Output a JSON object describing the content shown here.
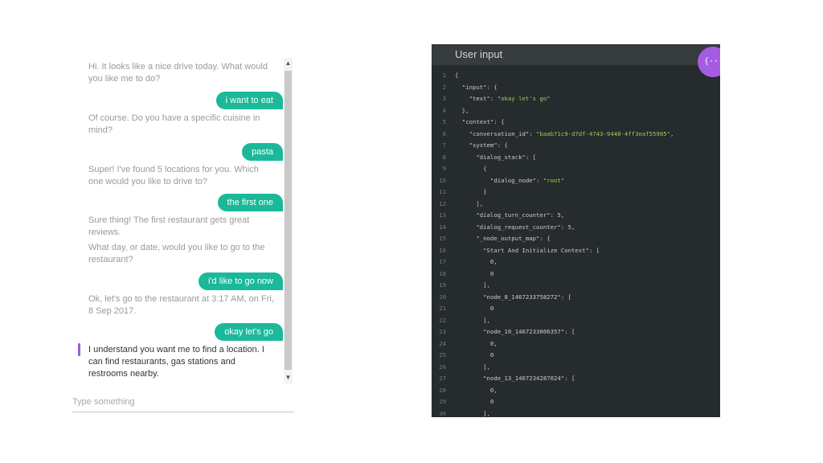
{
  "chat": {
    "messages": [
      {
        "from": "bot",
        "text": "Hi. It looks like a nice drive today. What would you like me to do?"
      },
      {
        "from": "user",
        "text": "i want to eat"
      },
      {
        "from": "bot",
        "text": "Of course. Do you have a specific cuisine in mind?"
      },
      {
        "from": "user",
        "text": "pasta"
      },
      {
        "from": "bot",
        "text": "Super! I've found 5 locations for you. Which one would you like to drive to?"
      },
      {
        "from": "user",
        "text": "the first one"
      },
      {
        "from": "bot",
        "text": "Sure thing! The first restaurant gets great reviews."
      },
      {
        "from": "bot",
        "text": "What day, or date, would you like to go to the restaurant?"
      },
      {
        "from": "user",
        "text": "i'd like to go now"
      },
      {
        "from": "bot",
        "text": "Ok, let's go to the restaurant at 3:17 AM, on Fri, 8 Sep 2017."
      },
      {
        "from": "user",
        "text": "okay let's go"
      },
      {
        "from": "bot",
        "text": "I understand you want me to find a location. I can find restaurants, gas stations and restrooms nearby."
      }
    ],
    "input_placeholder": "Type something",
    "accent_color": "#1bb89a",
    "marker_color": "#9a5fd6"
  },
  "json_panel": {
    "title": "User input",
    "toggle_icon": "{···}",
    "lines": [
      {
        "n": "1",
        "t": "{"
      },
      {
        "n": "2",
        "t": "  \"input\": {"
      },
      {
        "n": "3",
        "t": "    \"text\": \"okay let's go\""
      },
      {
        "n": "4",
        "t": "  },"
      },
      {
        "n": "5",
        "t": "  \"context\": {"
      },
      {
        "n": "6",
        "t": "    \"conversation_id\": \"baab71c9-d7df-4743-9448-4ff3eaf55905\","
      },
      {
        "n": "7",
        "t": "    \"system\": {"
      },
      {
        "n": "8",
        "t": "      \"dialog_stack\": ["
      },
      {
        "n": "9",
        "t": "        {"
      },
      {
        "n": "10",
        "t": "          \"dialog_node\": \"root\""
      },
      {
        "n": "11",
        "t": "        }"
      },
      {
        "n": "12",
        "t": "      ],"
      },
      {
        "n": "13",
        "t": "      \"dialog_turn_counter\": 5,"
      },
      {
        "n": "14",
        "t": "      \"dialog_request_counter\": 5,"
      },
      {
        "n": "15",
        "t": "      \"_node_output_map\": {"
      },
      {
        "n": "16",
        "t": "        \"Start And Initialize Context\": ["
      },
      {
        "n": "17",
        "t": "          0,"
      },
      {
        "n": "18",
        "t": "          0"
      },
      {
        "n": "19",
        "t": "        ],"
      },
      {
        "n": "20",
        "t": "        \"node_8_1467233758272\": ["
      },
      {
        "n": "21",
        "t": "          0"
      },
      {
        "n": "22",
        "t": "        ],"
      },
      {
        "n": "23",
        "t": "        \"node_10_1467233806357\": ["
      },
      {
        "n": "24",
        "t": "          0,"
      },
      {
        "n": "25",
        "t": "          0"
      },
      {
        "n": "26",
        "t": "        ],"
      },
      {
        "n": "27",
        "t": "        \"node_13_1467234287024\": ["
      },
      {
        "n": "28",
        "t": "          0,"
      },
      {
        "n": "29",
        "t": "          0"
      },
      {
        "n": "30",
        "t": "        ],"
      }
    ],
    "key_color": "#c9ccce",
    "string_color": "#9ccf56",
    "background": "#262b2e"
  }
}
